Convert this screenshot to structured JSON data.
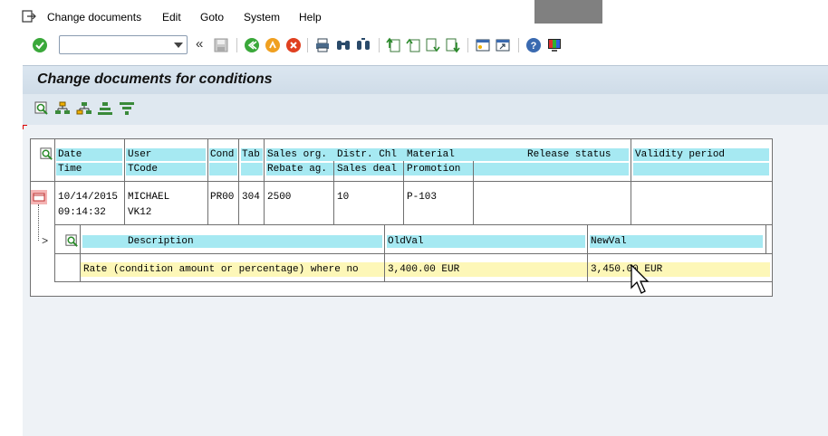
{
  "menu": {
    "items": [
      "Change documents",
      "Edit",
      "Goto",
      "System",
      "Help"
    ]
  },
  "toolbar": {
    "command_value": "",
    "back_label": "«"
  },
  "page": {
    "title": "Change documents for conditions"
  },
  "grid": {
    "header_row1": [
      "Date",
      "User",
      "Cond",
      "Tab",
      "Sales org.",
      "Distr. Chl",
      "Material",
      "Release status",
      "Validity period"
    ],
    "header_row2": [
      "Time",
      "TCode",
      "Rebate ag.",
      "Sales deal",
      "Promotion"
    ],
    "record": {
      "date": "10/14/2015",
      "time": "09:14:32",
      "user": "MICHAEL",
      "tcode": "VK12",
      "cond": "PR00",
      "tab": "304",
      "sales_org": "2500",
      "distr_chl": "10",
      "material": "P-103"
    },
    "detail_headers": [
      "Description",
      "OldVal",
      "NewVal"
    ],
    "detail_row": {
      "description": "Rate (condition amount or percentage) where no",
      "old_val": "3,400.00 EUR",
      "new_val": "3,450.00 EUR"
    }
  }
}
